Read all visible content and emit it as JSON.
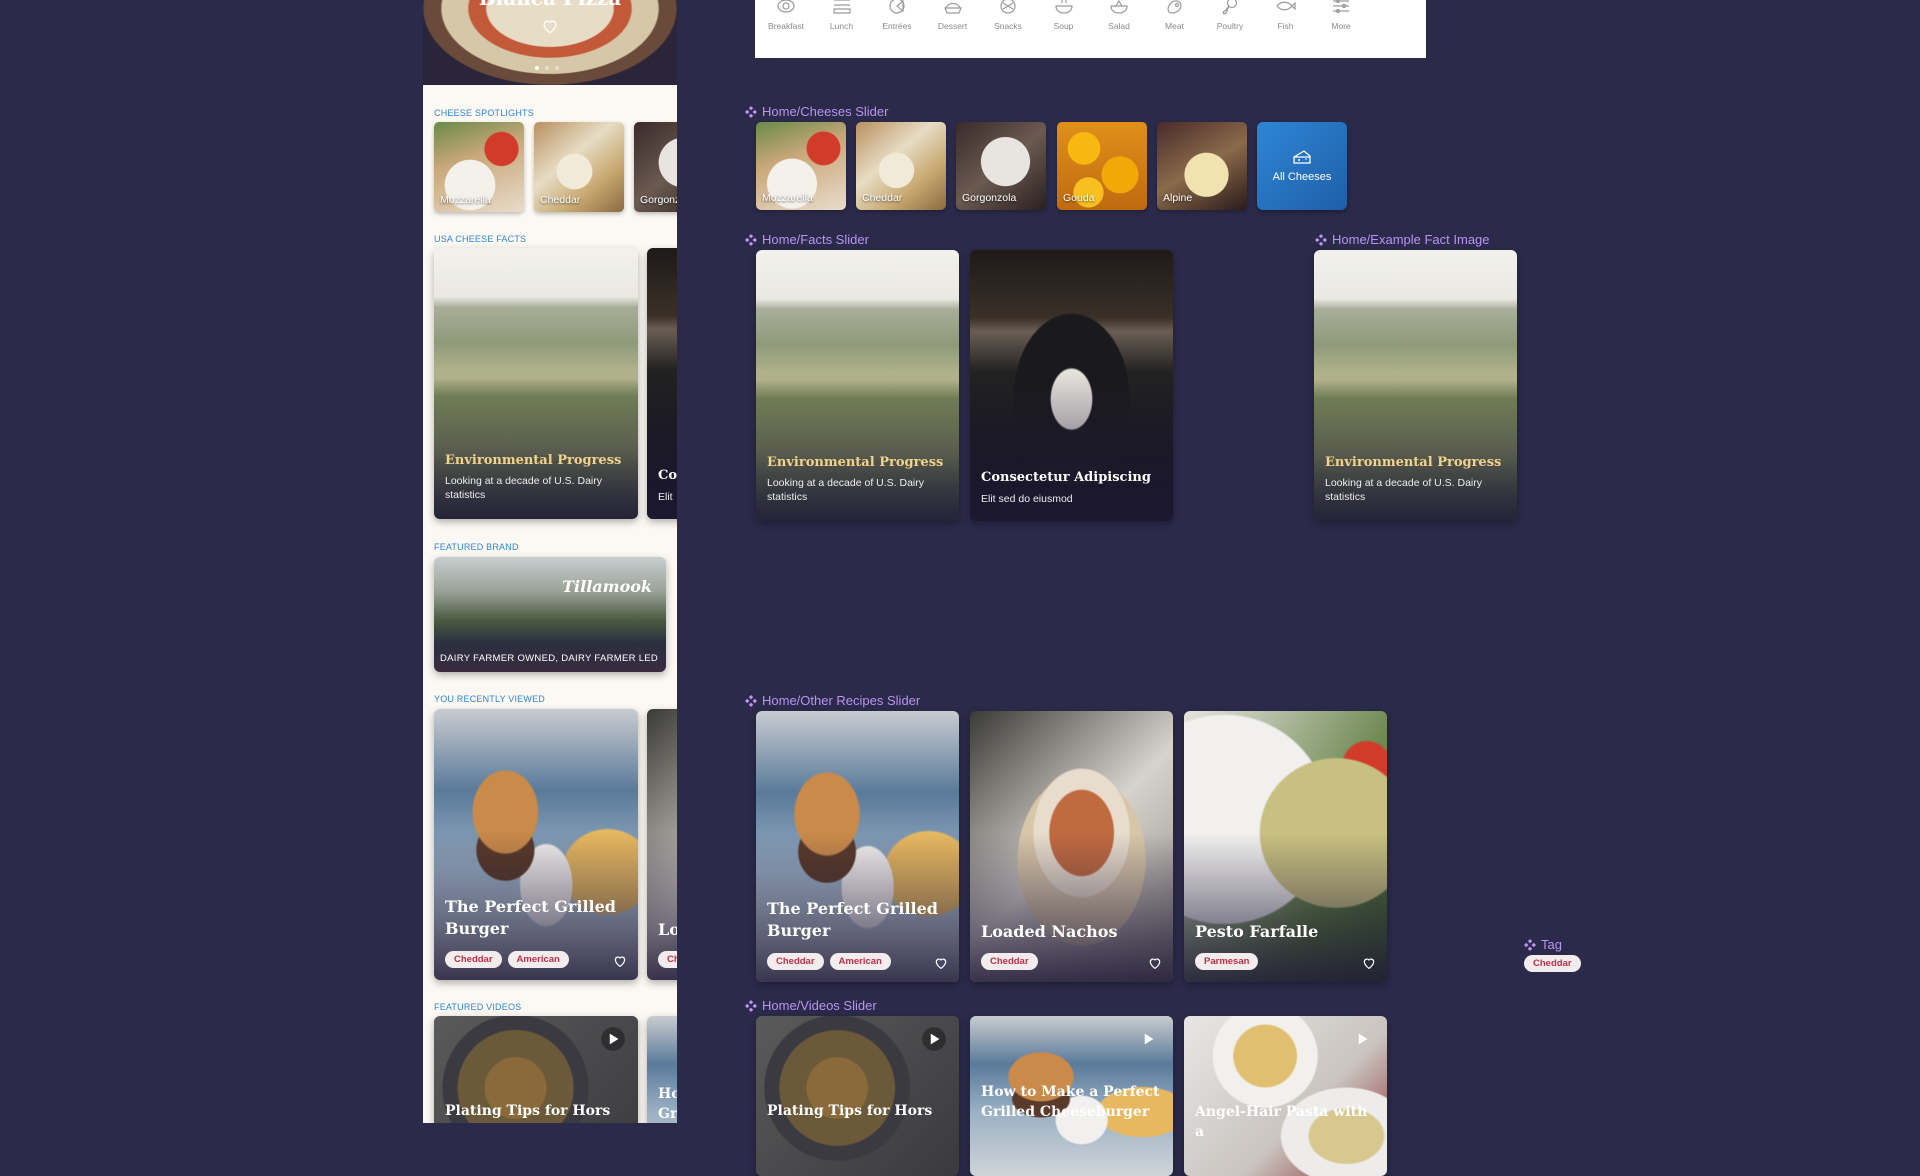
{
  "phone": {
    "hero": {
      "title": "Bianca Pizza",
      "heart_icon": "heart-outline-icon",
      "carousel_pages": 3,
      "active_page": 1
    },
    "sections": {
      "cheese_spotlights": {
        "label": "CHEESE SPOTLIGHTS",
        "items": [
          "Mozzarella",
          "Cheddar",
          "Gorgonzola"
        ]
      },
      "usa_cheese_facts": {
        "label": "USA CHEESE FACTS",
        "cards": [
          {
            "title": "Environmental Progress",
            "subtitle": "Looking at a decade of U.S. Dairy statistics"
          },
          {
            "title": "Co",
            "subtitle": "Elit"
          }
        ]
      },
      "featured_brand": {
        "label": "FEATURED BRAND",
        "brand": "Tillamook",
        "caption": "DAIRY FARMER OWNED, DAIRY FARMER LED"
      },
      "recently_viewed": {
        "label": "YOU RECENTLY VIEWED",
        "cards": [
          {
            "title": "The Perfect Grilled Burger",
            "tags": [
              "Cheddar",
              "American"
            ]
          },
          {
            "title": "Lo",
            "tags": [
              "Ch"
            ]
          }
        ]
      },
      "featured_videos": {
        "label": "FEATURED VIDEOS",
        "cards": [
          {
            "title": "Plating Tips for Hors"
          },
          {
            "title": "Ho Gr"
          }
        ]
      }
    }
  },
  "canvas": {
    "categories": [
      "Breakfast",
      "Lunch",
      "Entrées",
      "Dessert",
      "Snacks",
      "Soup",
      "Salad",
      "Meat",
      "Poultry",
      "Fish",
      "More"
    ],
    "frames": {
      "cheeses_slider": {
        "label": "Home/Cheeses Slider",
        "items": [
          "Mozzarella",
          "Cheddar",
          "Gorgonzola",
          "Gouda",
          "Alpine"
        ],
        "all_button": "All Cheeses"
      },
      "facts_slider": {
        "label": "Home/Facts Slider",
        "cards": [
          {
            "title": "Environmental Progress",
            "subtitle": "Looking at a decade of U.S. Dairy statistics"
          },
          {
            "title": "Consectetur Adipiscing",
            "subtitle": "Elit sed do eiusmod"
          }
        ]
      },
      "example_fact_image": {
        "label": "Home/Example Fact Image",
        "card": {
          "title": "Environmental Progress",
          "subtitle": "Looking at a decade of U.S. Dairy statistics"
        }
      },
      "other_recipes_slider": {
        "label": "Home/Other Recipes Slider",
        "cards": [
          {
            "title": "The Perfect Grilled Burger",
            "tags": [
              "Cheddar",
              "American"
            ]
          },
          {
            "title": "Loaded Nachos",
            "tags": [
              "Cheddar"
            ]
          },
          {
            "title": "Pesto Farfalle",
            "tags": [
              "Parmesan"
            ]
          }
        ]
      },
      "tag_component": {
        "label": "Tag",
        "tag": "Cheddar"
      },
      "videos_slider": {
        "label": "Home/Videos Slider",
        "cards": [
          {
            "title": "Plating Tips for Hors"
          },
          {
            "title": "How to Make a Perfect Grilled Cheeseburger"
          },
          {
            "title": "Angel-Hair Pasta with a"
          }
        ]
      }
    }
  },
  "colors": {
    "canvas_bg": "#2b2a4a",
    "phone_bg": "#fcf8f3",
    "section_label": "#2f86d6",
    "frame_label": "#b994f0",
    "fact_title": "#f2d38b",
    "tag_text": "#c0304a",
    "all_cheeses_bg": "#2d86d6"
  }
}
